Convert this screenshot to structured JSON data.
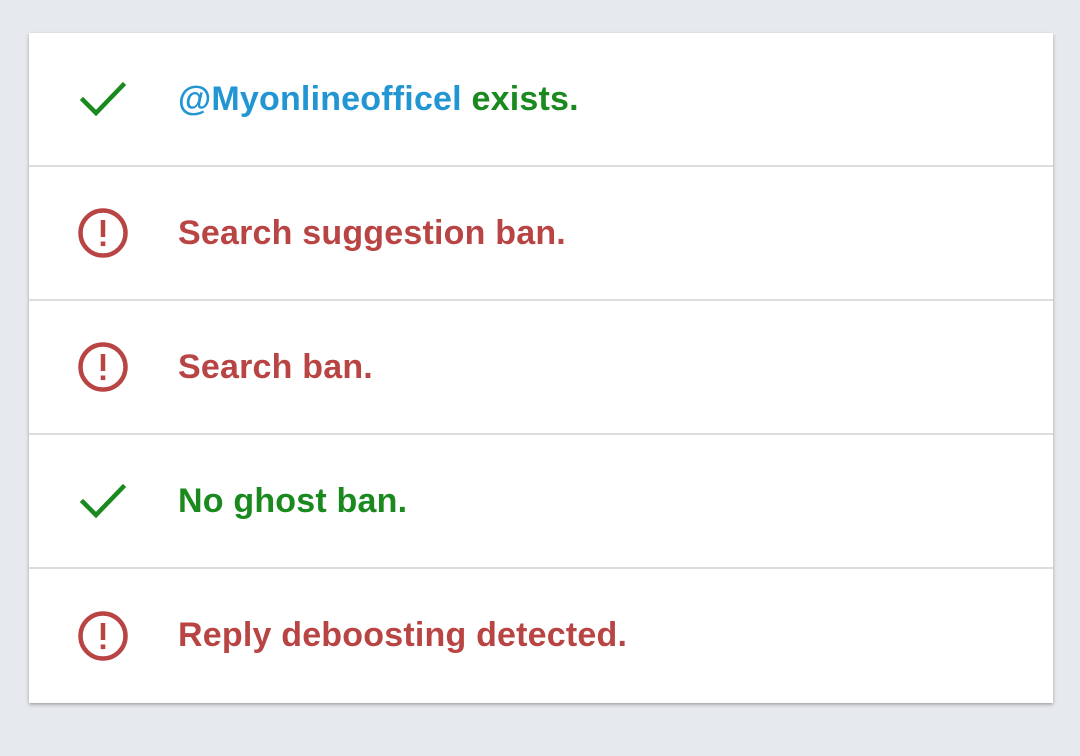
{
  "colors": {
    "ok": "#1a8a1e",
    "bad": "#b94444",
    "handle": "#2196d3",
    "background": "#e6e9ed"
  },
  "results": [
    {
      "status": "ok",
      "icon": "check-icon",
      "handle": "@Myonlineofficel",
      "text": " exists."
    },
    {
      "status": "bad",
      "icon": "alert-circle-icon",
      "text": "Search suggestion ban."
    },
    {
      "status": "bad",
      "icon": "alert-circle-icon",
      "text": "Search ban."
    },
    {
      "status": "ok",
      "icon": "check-icon",
      "text": "No ghost ban."
    },
    {
      "status": "bad",
      "icon": "alert-circle-icon",
      "text": "Reply deboosting detected."
    }
  ]
}
